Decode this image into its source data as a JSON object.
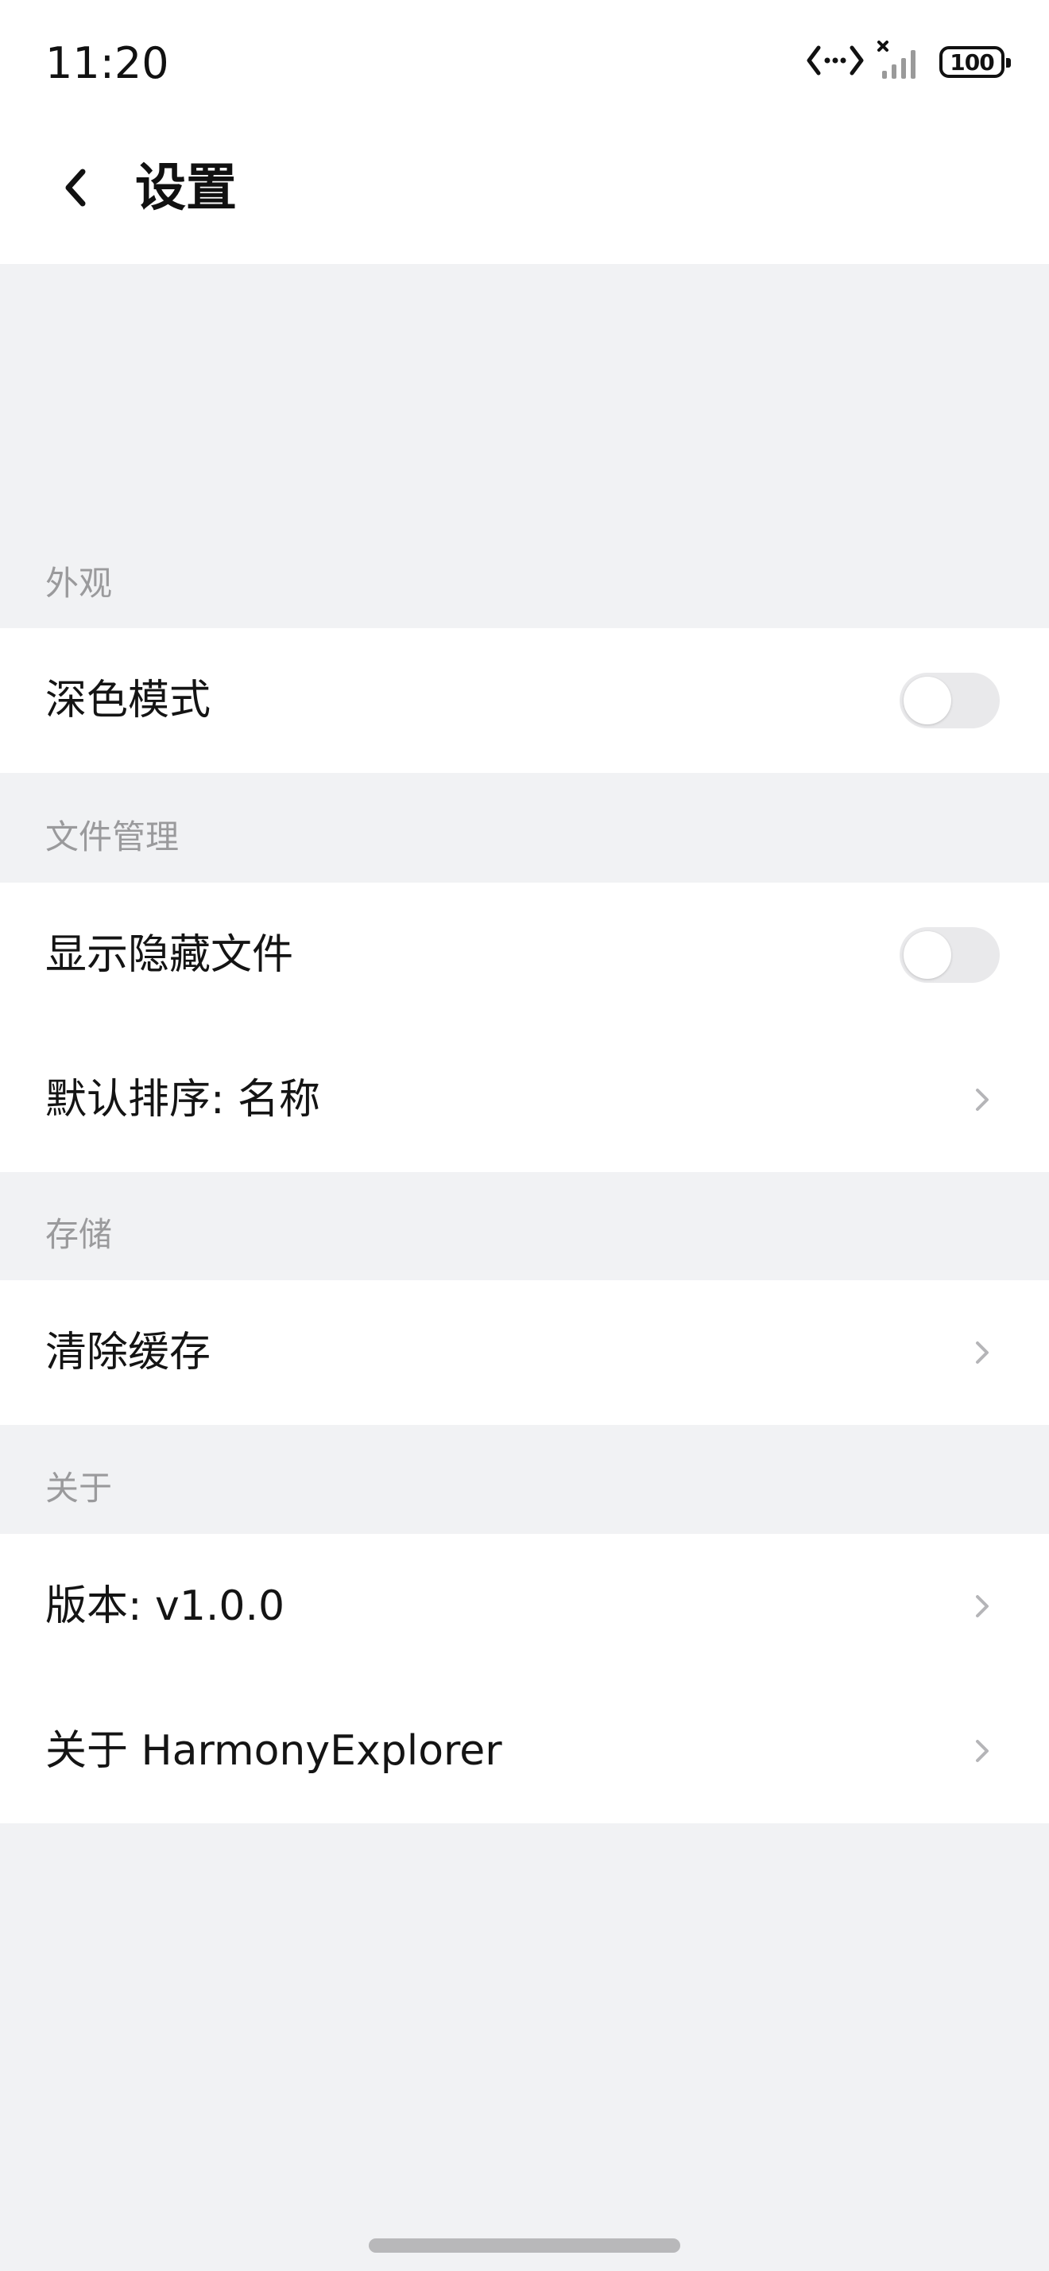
{
  "status_bar": {
    "time": "11:20",
    "battery": "100",
    "icons": [
      "data-transfer-icon",
      "no-signal-icon",
      "battery-icon"
    ]
  },
  "header": {
    "title": "设置",
    "back_icon": "chevron-left-icon"
  },
  "sections": {
    "appearance": {
      "label": "外观",
      "dark_mode": {
        "label": "深色模式",
        "enabled": false
      }
    },
    "file_management": {
      "label": "文件管理",
      "show_hidden": {
        "label": "显示隐藏文件",
        "enabled": false
      },
      "default_sort": {
        "label": "默认排序: 名称"
      }
    },
    "storage": {
      "label": "存储",
      "clear_cache": {
        "label": "清除缓存"
      }
    },
    "about": {
      "label": "关于",
      "version": {
        "label": "版本: v1.0.0"
      },
      "about_app": {
        "label": "关于 HarmonyExplorer"
      }
    }
  },
  "colors": {
    "background": "#f1f2f4",
    "card": "#ffffff",
    "section_label": "#9a9a9c",
    "toggle_off": "#e9e9eb",
    "chevron": "#b5b5b8"
  }
}
